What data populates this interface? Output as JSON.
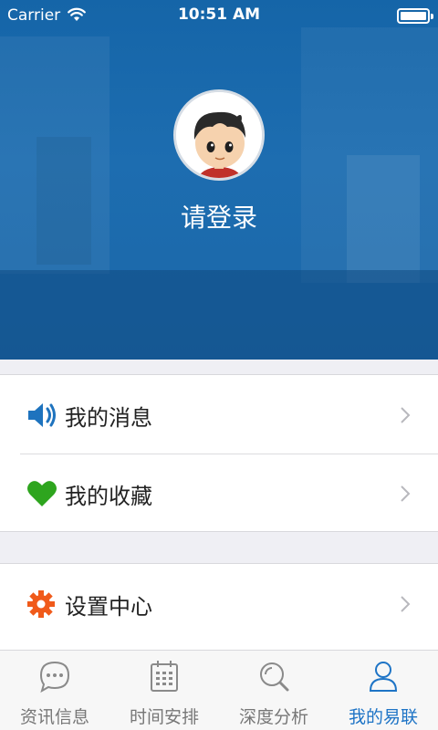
{
  "status_bar": {
    "carrier": "Carrier",
    "time": "10:51 AM"
  },
  "profile": {
    "login_prompt": "请登录"
  },
  "menu_group_1": [
    {
      "label": "我的消息",
      "icon": "speaker-icon",
      "icon_color": "#1e73be"
    },
    {
      "label": "我的收藏",
      "icon": "heart-icon",
      "icon_color": "#2ea51e"
    }
  ],
  "menu_group_2": [
    {
      "label": "设置中心",
      "icon": "gear-icon",
      "icon_color": "#f05a1a"
    }
  ],
  "tab_bar": {
    "tabs": [
      {
        "label": "资讯信息",
        "icon": "chat-bubble-icon",
        "active": false
      },
      {
        "label": "时间安排",
        "icon": "calendar-icon",
        "active": false
      },
      {
        "label": "深度分析",
        "icon": "magnifier-icon",
        "active": false
      },
      {
        "label": "我的易联",
        "icon": "person-icon",
        "active": true
      }
    ],
    "active_color": "#1e74c6",
    "inactive_color": "#777777"
  }
}
